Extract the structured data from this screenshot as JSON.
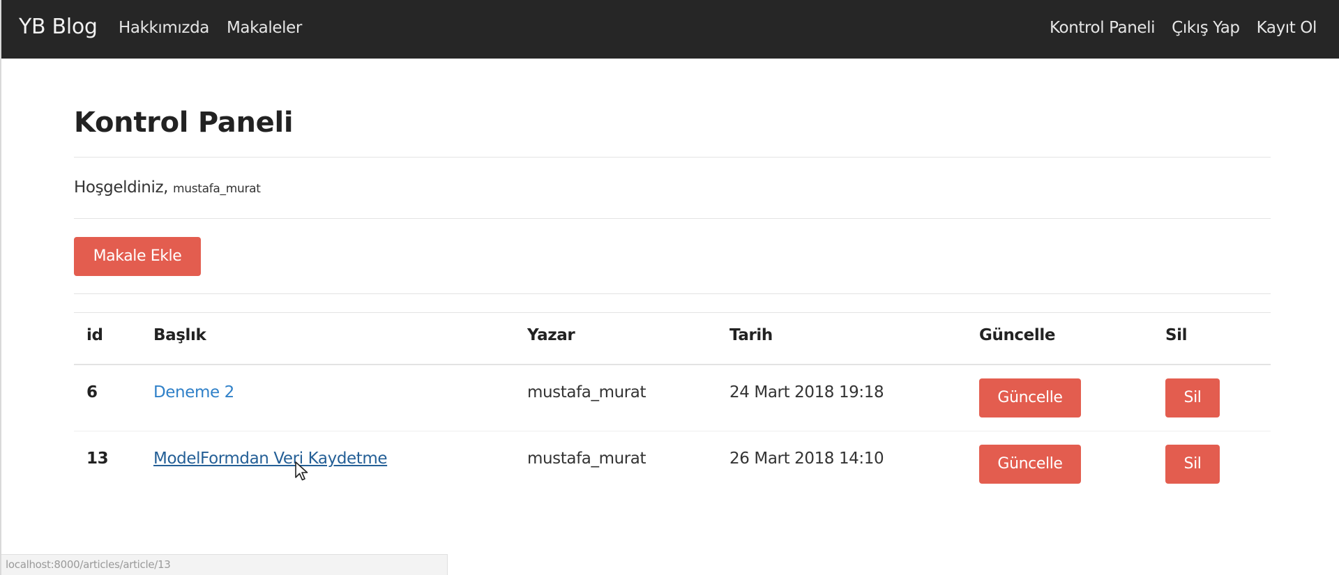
{
  "navbar": {
    "brand": "YB Blog",
    "left_links": [
      "Hakkımızda",
      "Makaleler"
    ],
    "right_links": [
      "Kontrol Paneli",
      "Çıkış Yap",
      "Kayıt Ol"
    ]
  },
  "page": {
    "title": "Kontrol Paneli",
    "welcome_text": "Hoşgeldiniz,",
    "username": "mustafa_murat",
    "add_button": "Makale Ekle"
  },
  "table": {
    "headers": {
      "id": "id",
      "title": "Başlık",
      "author": "Yazar",
      "date": "Tarih",
      "update": "Güncelle",
      "delete": "Sil"
    },
    "rows": [
      {
        "id": "6",
        "title": "Deneme 2",
        "author": "mustafa_murat",
        "date": "24 Mart 2018 19:18",
        "update_label": "Güncelle",
        "delete_label": "Sil"
      },
      {
        "id": "13",
        "title": "ModelFormdan Veri Kaydetme",
        "author": "mustafa_murat",
        "date": "26 Mart 2018 14:10",
        "update_label": "Güncelle",
        "delete_label": "Sil"
      }
    ]
  },
  "statusbar": {
    "url": "localhost:8000/articles/article/13"
  },
  "colors": {
    "navbar_bg": "#262626",
    "danger_button": "#e35d4f",
    "link": "#2f80c8"
  }
}
